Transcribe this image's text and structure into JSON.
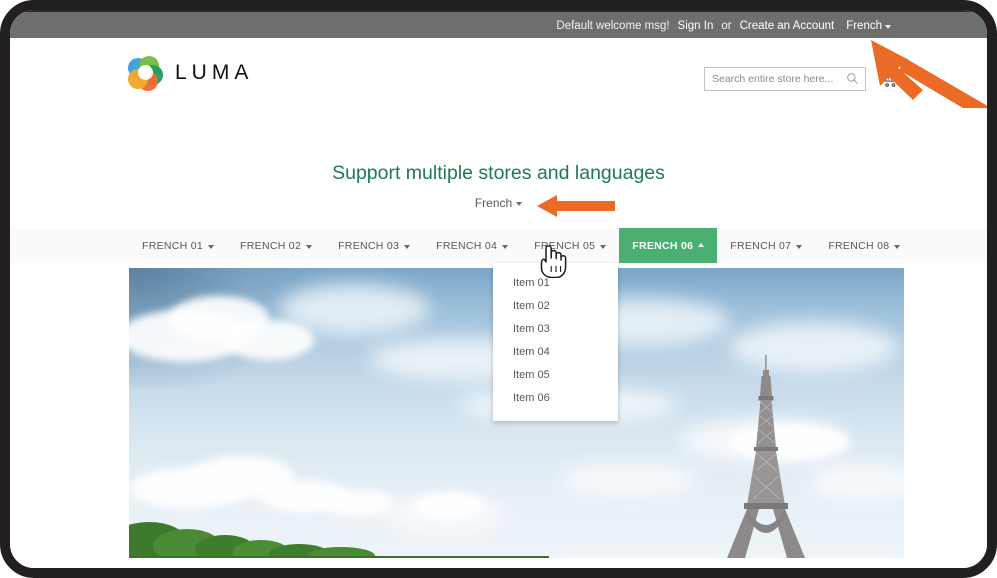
{
  "top_bar": {
    "welcome_msg": "Default welcome msg!",
    "sign_in_label": "Sign In",
    "or_label": "or",
    "create_account_label": "Create an Account",
    "language_label": "French",
    "language_caret_icon": "chevron-down-icon"
  },
  "header": {
    "logo_text": "LUMA",
    "logo_icon": "luma-flower-logo-icon",
    "search_placeholder": "Search entire store here...",
    "search_value": "",
    "search_icon": "search-icon",
    "cart_icon": "shopping-cart-icon"
  },
  "page": {
    "title": "Support multiple stores and languages",
    "store_switcher_label": "French",
    "store_switcher_caret_icon": "chevron-down-icon"
  },
  "nav": {
    "items": [
      {
        "label": "FRENCH 01",
        "active": false,
        "caret_icon": "chevron-down-icon"
      },
      {
        "label": "FRENCH 02",
        "active": false,
        "caret_icon": "chevron-down-icon"
      },
      {
        "label": "FRENCH 03",
        "active": false,
        "caret_icon": "chevron-down-icon"
      },
      {
        "label": "FRENCH 04",
        "active": false,
        "caret_icon": "chevron-down-icon"
      },
      {
        "label": "FRENCH 05",
        "active": false,
        "caret_icon": "chevron-down-icon"
      },
      {
        "label": "FRENCH 06",
        "active": true,
        "caret_icon": "chevron-up-icon"
      },
      {
        "label": "FRENCH 07",
        "active": false,
        "caret_icon": "chevron-down-icon"
      },
      {
        "label": "FRENCH 08",
        "active": false,
        "caret_icon": "chevron-down-icon"
      }
    ]
  },
  "dropdown": {
    "open_for": "FRENCH 06",
    "items": [
      {
        "label": "Item 01"
      },
      {
        "label": "Item 02"
      },
      {
        "label": "Item 03"
      },
      {
        "label": "Item 04"
      },
      {
        "label": "Item 05"
      },
      {
        "label": "Item 06"
      }
    ]
  },
  "hero": {
    "alt": "Eiffel Tower under a blue sky with clouds and trees"
  },
  "annotations": [
    {
      "name": "arrow-pointing-to-top-language-switcher",
      "direction": "up-left",
      "color": "#ea6a26"
    },
    {
      "name": "arrow-pointing-to-store-switcher",
      "direction": "left",
      "color": "#ea6a26"
    }
  ],
  "cursor": {
    "type": "pointing-hand-cursor"
  },
  "colors": {
    "top_bar_bg": "#6d6e6e",
    "nav_bg": "#fafafa",
    "nav_active_bg": "#4caf72",
    "heading_green": "#1f7a4f",
    "annotation_orange": "#ea6a26",
    "frame_dark": "#231f20"
  }
}
